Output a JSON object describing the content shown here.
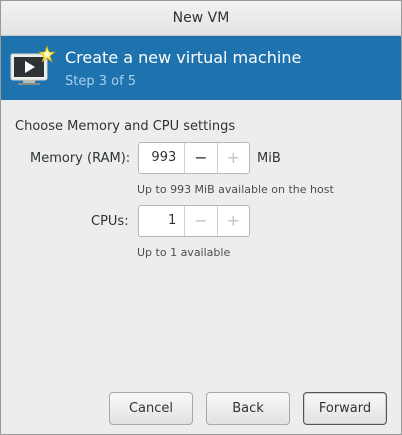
{
  "window": {
    "title": "New VM"
  },
  "banner": {
    "title": "Create a new virtual machine",
    "step": "Step 3 of 5",
    "icon": "vm-wizard-icon"
  },
  "settings": {
    "heading": "Choose Memory and CPU settings",
    "memory": {
      "label": "Memory (RAM):",
      "value": "993",
      "decrement": "−",
      "increment": "+",
      "unit": "MiB",
      "hint": "Up to 993 MiB available on the host"
    },
    "cpus": {
      "label": "CPUs:",
      "value": "1",
      "decrement": "−",
      "increment": "+",
      "hint": "Up to 1 available"
    }
  },
  "buttons": {
    "cancel": "Cancel",
    "back": "Back",
    "forward": "Forward"
  },
  "colors": {
    "banner_bg": "#1e72ad",
    "banner_step": "#a9d0ee",
    "window_bg": "#ededed"
  }
}
